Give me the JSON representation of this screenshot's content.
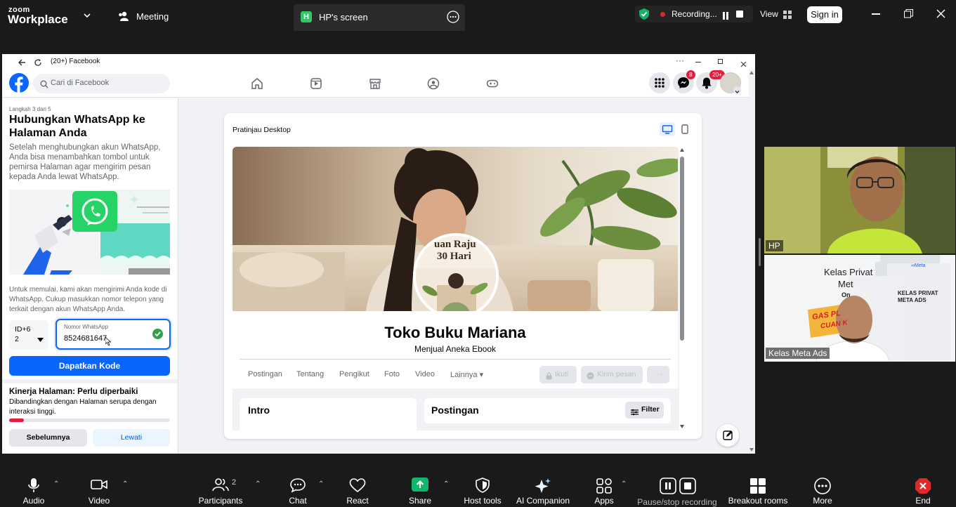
{
  "zoom": {
    "brand_line1": "zoom",
    "brand_line2": "Workplace",
    "meeting_label": "Meeting",
    "share_tab_initial": "H",
    "share_tab_title": "HP's screen",
    "recording_label": "Recording...",
    "view_label": "View",
    "signin_label": "Sign in"
  },
  "browser": {
    "tab_title": "(20+) Facebook"
  },
  "fb": {
    "search_placeholder": "Cari di Facebook",
    "messenger_badge": "8",
    "notif_badge": "20+"
  },
  "panel": {
    "step": "Langkah 3 dari 5",
    "title": "Hubungkan WhatsApp ke Halaman Anda",
    "desc": "Setelah menghubungkan akun WhatsApp, Anda bisa menambahkan tombol untuk pemirsa Halaman agar mengirim pesan kepada Anda lewat WhatsApp.",
    "instruction": "Untuk memulai, kami akan mengirimi Anda kode di WhatsApp. Cukup masukkan nomor telepon yang terkait dengan akun WhatsApp Anda.",
    "country_code_line1": "ID+6",
    "country_code_line2": "2",
    "phone_label": "Nomor WhatsApp",
    "phone_value": "8524681647",
    "get_code_button": "Dapatkan Kode",
    "perf_title": "Kinerja Halaman: Perlu diperbaiki",
    "perf_desc": "Dibandingkan dengan Halaman serupa dengan interaksi tinggi.",
    "perf_progress": 0.09,
    "prev_button": "Sebelumnya",
    "skip_button": "Lewati"
  },
  "preview": {
    "header": "Pratinjau Desktop",
    "cover_book_title_1": "uan Raju",
    "cover_book_title_2": "30 Hari",
    "page_name": "Toko Buku Mariana",
    "page_subtitle": "Menjual Aneka Ebook",
    "tabs": [
      "Postingan",
      "Tentang",
      "Pengikut",
      "Foto",
      "Video",
      "Lainnya ▾"
    ],
    "follow_button": "Ikuti",
    "message_button": "Kirim pesan",
    "more_button": "···",
    "intro_title": "Intro",
    "posts_title": "Postingan",
    "filter_button": "Filter"
  },
  "participants": {
    "tile1_name": "HP",
    "tile2_name": "Kelas Meta Ads",
    "tile2_poster_line1": "Kelas Privat",
    "tile2_poster_line2": "Met",
    "tile2_poster_line3": "On",
    "tile2_box_title": "KELAS PRIVAT META ADS",
    "tile2_sticker": "GAS PL",
    "tile2_sticker2": "CUAN K",
    "tile2_meta": "∞Meta"
  },
  "toolbar": {
    "audio": "Audio",
    "video": "Video",
    "participants": "Participants",
    "participants_count": "2",
    "chat": "Chat",
    "react": "React",
    "share": "Share",
    "host_tools": "Host tools",
    "ai_companion": "AI Companion",
    "apps": "Apps",
    "pause_stop_recording": "Pause/stop recording",
    "breakout_rooms": "Breakout rooms",
    "more": "More",
    "end": "End"
  },
  "colors": {
    "fb_blue": "#0866ff",
    "zoom_green": "#0fb66b",
    "end_red": "#e02828",
    "progress_red": "#e41e3f"
  }
}
